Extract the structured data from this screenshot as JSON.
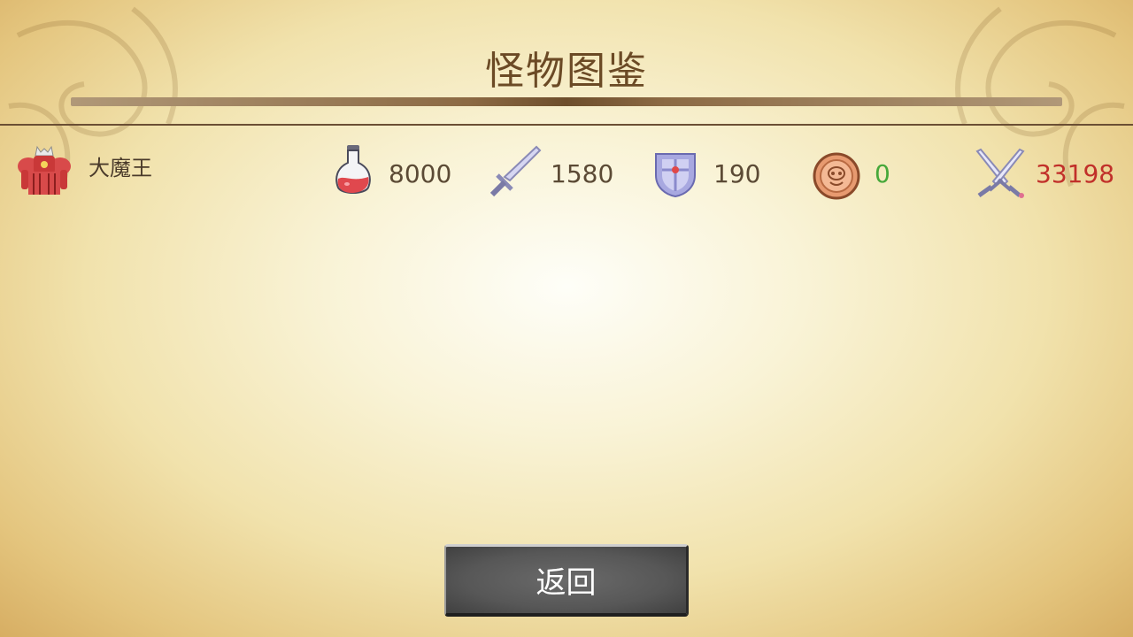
{
  "header": {
    "title": "怪物图鉴"
  },
  "monsters": [
    {
      "name": "大魔王",
      "avatar_icon": "demon-king-icon",
      "hp": "8000",
      "attack": "1580",
      "defense": "190",
      "gold": "0",
      "damage": "33198"
    }
  ],
  "icons": {
    "hp": "potion-icon",
    "attack": "sword-icon",
    "defense": "shield-icon",
    "gold": "coin-icon",
    "damage": "crossed-swords-icon"
  },
  "colors": {
    "title": "#6b4a25",
    "stat_text": "#5b4a35",
    "gold_text": "#46a83a",
    "damage_text": "#c1302a"
  },
  "footer": {
    "back_label": "返回"
  }
}
